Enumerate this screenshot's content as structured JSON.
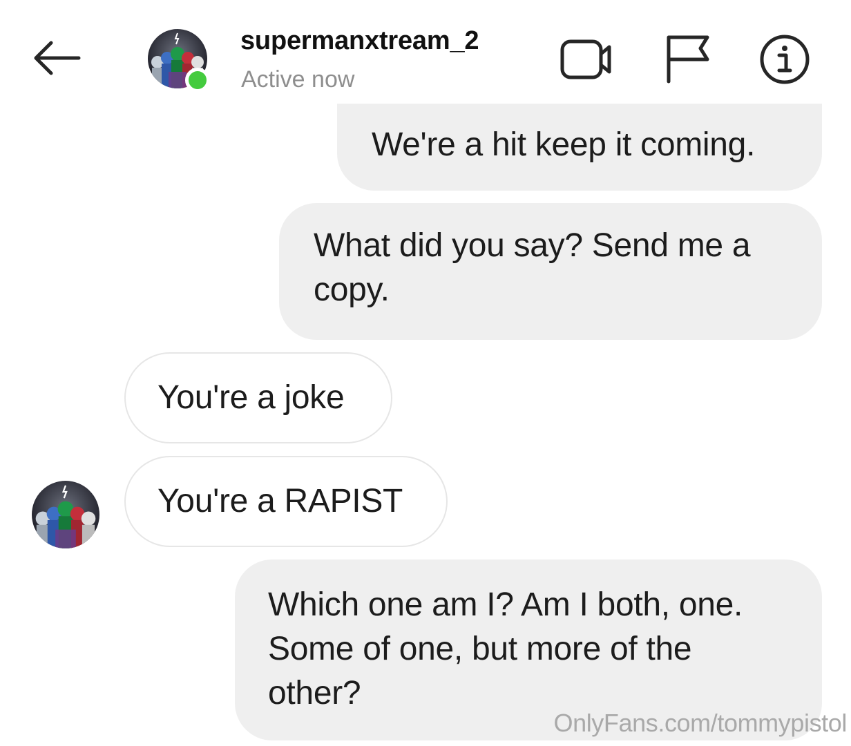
{
  "header": {
    "back_icon": "arrow-left-icon",
    "username": "supermanxtream_2",
    "status": "Active now",
    "status_color": "#44cb3e",
    "actions": [
      {
        "name": "video-call",
        "icon": "video-camera-icon"
      },
      {
        "name": "report",
        "icon": "flag-icon"
      },
      {
        "name": "info",
        "icon": "info-circle-icon"
      }
    ]
  },
  "messages": [
    {
      "direction": "sent",
      "text": "We're a hit keep it coming."
    },
    {
      "direction": "sent",
      "text": "What did you say? Send me a\ncopy."
    },
    {
      "direction": "received",
      "text": "You're a joke"
    },
    {
      "direction": "received",
      "text": "You're a RAPIST"
    },
    {
      "direction": "sent",
      "text": "Which one am I? Am I both, one.\nSome of one, but more of the\nother?"
    }
  ],
  "colors": {
    "sent_bubble": "#efefef",
    "received_border": "#e6e6e6",
    "secondary_text": "#8e8e8e"
  },
  "watermark": "OnlyFans.com/tommypistol"
}
